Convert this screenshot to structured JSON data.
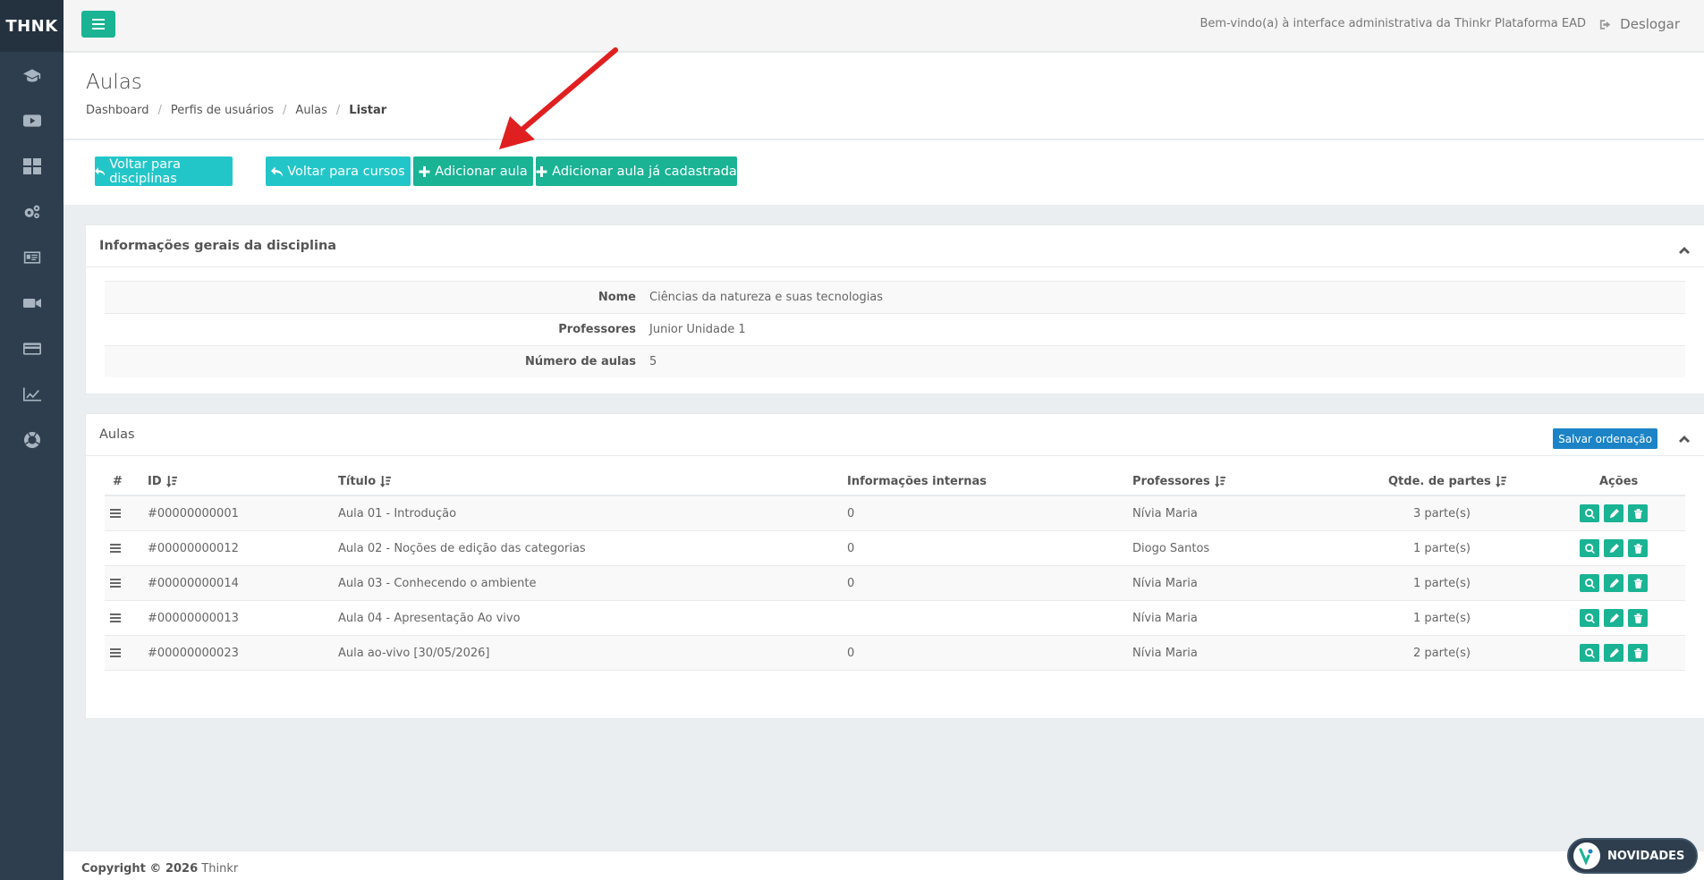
{
  "brand": "THNK",
  "sidebar_items": [
    "graduation-cap-icon",
    "youtube-icon",
    "dashboard-icon",
    "cogs-icon",
    "id-card-icon",
    "video-camera-icon",
    "credit-card-icon",
    "line-chart-icon",
    "life-ring-icon"
  ],
  "header": {
    "welcome": "Bem-vindo(a) à interface administrativa da Thinkr Plataforma EAD",
    "logout": "Deslogar"
  },
  "page": {
    "title": "Aulas",
    "breadcrumb": [
      "Dashboard",
      "Perfis de usuários",
      "Aulas",
      "Listar"
    ]
  },
  "actions": {
    "back_disciplines": "Voltar para disciplinas",
    "back_courses": "Voltar para cursos",
    "add_lesson": "Adicionar aula",
    "add_existing": "Adicionar aula já cadastrada"
  },
  "info_panel": {
    "title": "Informações gerais da disciplina",
    "rows": [
      {
        "label": "Nome",
        "value": "Ciências da natureza e suas tecnologias"
      },
      {
        "label": "Professores",
        "value": "Junior Unidade 1"
      },
      {
        "label": "Número de aulas",
        "value": "5"
      }
    ]
  },
  "lessons_panel": {
    "title": "Aulas",
    "save_order": "Salvar ordenação",
    "columns": {
      "hash": "#",
      "id": "ID",
      "title": "Título",
      "internal": "Informações internas",
      "teachers": "Professores",
      "parts": "Qtde. de partes",
      "actions": "Ações"
    },
    "rows": [
      {
        "id": "#00000000001",
        "title": "Aula 01 - Introdução",
        "internal": "0",
        "teacher": "Nívia Maria",
        "parts": "3 parte(s)"
      },
      {
        "id": "#00000000012",
        "title": "Aula 02 - Noções de edição das categorias",
        "internal": "0",
        "teacher": "Diogo Santos",
        "parts": "1 parte(s)"
      },
      {
        "id": "#00000000014",
        "title": "Aula 03 - Conhecendo o ambiente",
        "internal": "0",
        "teacher": "Nívia Maria",
        "parts": "1 parte(s)"
      },
      {
        "id": "#00000000013",
        "title": "Aula 04 - Apresentação Ao vivo",
        "internal": "",
        "teacher": "Nívia Maria",
        "parts": "1 parte(s)"
      },
      {
        "id": "#00000000023",
        "title": "Aula ao-vivo [30/05/2026]",
        "internal": "0",
        "teacher": "Nívia Maria",
        "parts": "2 parte(s)"
      }
    ]
  },
  "footer": {
    "copyright_bold": "Copyright © 2026",
    "company": "Thinkr"
  },
  "novidades": "NOVIDADES",
  "colors": {
    "sidebar": "#2e3e4e",
    "primary": "#1ab394",
    "info": "#23c6c8",
    "save": "#1c84c6",
    "annotation_arrow": "#e02020"
  }
}
